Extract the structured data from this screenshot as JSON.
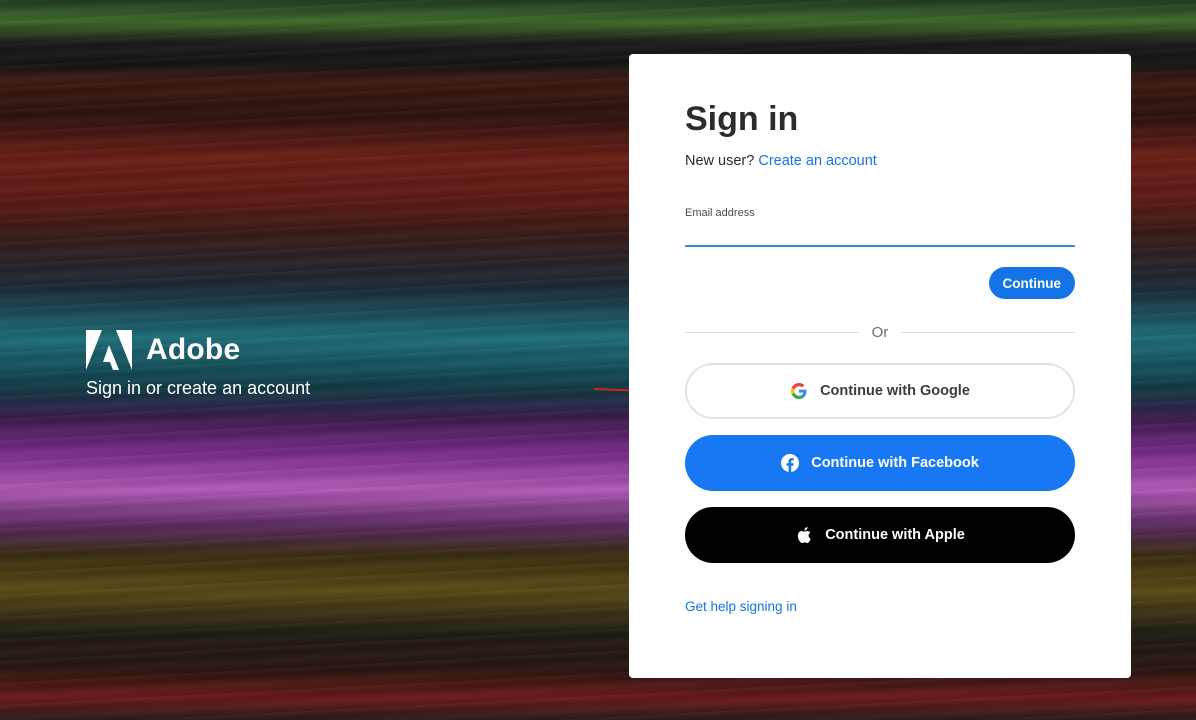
{
  "brand": {
    "name": "Adobe",
    "tagline": "Sign in or create an account"
  },
  "card": {
    "title": "Sign in",
    "new_user_prompt": "New user?",
    "create_account_link": "Create an account",
    "email_label": "Email address",
    "email_value": "",
    "continue_button": "Continue",
    "divider_text": "Or",
    "google_button": "Continue with Google",
    "facebook_button": "Continue with Facebook",
    "apple_button": "Continue with Apple",
    "help_link": "Get help signing in"
  },
  "icons": {
    "brand_logo": "adobe-logo-icon",
    "google": "google-icon",
    "facebook": "facebook-icon",
    "apple": "apple-icon",
    "annotation_arrow": "red-arrow-icon"
  },
  "colors": {
    "accent": "#1473e6",
    "facebook": "#1877f2",
    "apple": "#000000",
    "arrow": "#d42020"
  }
}
